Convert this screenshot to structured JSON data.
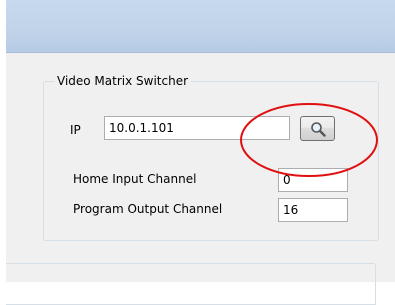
{
  "group": {
    "title": "Video Matrix Switcher",
    "ip_label": "IP",
    "ip_value": "10.0.1.101",
    "home_input_label": "Home Input Channel",
    "home_input_value": "0",
    "program_output_label": "Program Output Channel",
    "program_output_value": "16"
  },
  "icons": {
    "search_button_icon": "magnifier-icon"
  },
  "colors": {
    "annotation_circle": "#e01010",
    "titlebar": "#c0d3e9",
    "window": "#f0f0f0"
  }
}
